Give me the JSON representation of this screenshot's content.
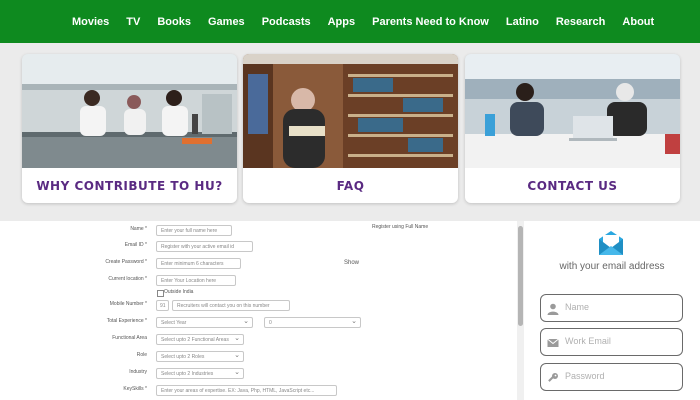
{
  "nav": {
    "items": [
      "Movies",
      "TV",
      "Books",
      "Games",
      "Podcasts",
      "Apps",
      "Parents Need to Know",
      "Latino",
      "Research",
      "About"
    ]
  },
  "cards": [
    {
      "label": "WHY CONTRIBUTE TO HU?"
    },
    {
      "label": "FAQ"
    },
    {
      "label": "CONTACT US"
    }
  ],
  "form": {
    "name": {
      "label": "Name *",
      "placeholder": "Enter your full name here",
      "hint": "Register using Full Name"
    },
    "email": {
      "label": "Email ID *",
      "placeholder": "Register with your active email id"
    },
    "password": {
      "label": "Create Password *",
      "placeholder": "Enter minimum 6 characters",
      "show": "Show"
    },
    "location": {
      "label": "Current location *",
      "placeholder": "Enter Your Location here",
      "outside_india": "Outside India"
    },
    "mobile": {
      "label": "Mobile Number *",
      "code": "91",
      "placeholder": "Recruiters will contact you on this number"
    },
    "experience": {
      "label": "Total Experience *",
      "years": "Select Year",
      "months": "0"
    },
    "functional_area": {
      "label": "Functional Area",
      "placeholder": "Select upto 2 Functional Areas"
    },
    "role": {
      "label": "Role",
      "placeholder": "Select upto 2 Roles"
    },
    "industry": {
      "label": "Industry",
      "placeholder": "Select upto 2 Industries"
    },
    "keyskills": {
      "label": "KeySkills *",
      "placeholder": "Enter your areas of expertise. EX: Java, Php, HTML, JavaScript etc..."
    }
  },
  "signup": {
    "heading": "with your email address",
    "name_placeholder": "Name",
    "email_placeholder": "Work Email",
    "password_placeholder": "Password"
  },
  "colors": {
    "nav_bg": "#0e8a1f",
    "card_label": "#5a2a82",
    "email_icon": "#2aa7e0"
  }
}
